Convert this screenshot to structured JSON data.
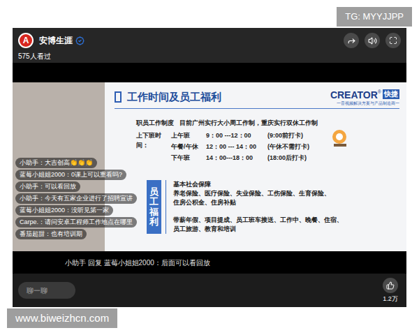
{
  "watermarks": {
    "top": "TG: MYYJJPP",
    "bottom": "www.biweizhcn.com"
  },
  "channel": {
    "logo": "A",
    "name": "安博生涯",
    "verified": true,
    "views": "575人看过"
  },
  "slide": {
    "title": "工作时间及员工福利",
    "brand": {
      "name": "CREATOR",
      "mark": "®",
      "cn": "快捷",
      "tagline": "一音视频解决方案与产品制造商一"
    },
    "policy": {
      "label": "职员工作制度",
      "text": "目前广州实行大小周工作制，重庆实行双休工作制"
    },
    "schedule": {
      "label": "上下班时间：",
      "rows": [
        {
          "name": "上午班",
          "time": "9：00 ---12：00",
          "note": "(9:00前打卡)"
        },
        {
          "name": "午餐/午休",
          "time": "12：00 --- 14：00",
          "note": "(午休不需打卡)"
        },
        {
          "name": "下午班",
          "time": "14：00---18：00",
          "note": "(18:00后打卡)"
        }
      ]
    },
    "benefits": {
      "label": "员工福利",
      "groups": [
        {
          "lines": [
            "基本社会保障",
            "养老保险、医疗保险、失业保险、工伤保险、生育保险、",
            "住房公积金、住房补贴"
          ]
        },
        {
          "lines": [
            "带薪年假、项目提成、员工班车接送、工作中、晚餐、住宿、",
            "员工旅游、教育和培训"
          ]
        }
      ]
    }
  },
  "chat": [
    {
      "text": "小助手：大吉创高👏👏👏"
    },
    {
      "text": "蓝莓小姐姐2000：0课上可以重看吗?"
    },
    {
      "text": "小助手：可以看回放"
    },
    {
      "text": "小助手：今天有五家企业进行了招聘宣讲"
    },
    {
      "text": "蓝莓小姐姐2000：没听见第一家"
    },
    {
      "text": "Carpe.：请问安卓工程师工作地点在哪里"
    },
    {
      "text": "番茄超甜：也有培训期"
    }
  ],
  "reply": "小助手 回复 蓝莓小姐姐2000：后面可以看回放",
  "input": {
    "placeholder": "聊一聊"
  },
  "likes": "1.2万"
}
